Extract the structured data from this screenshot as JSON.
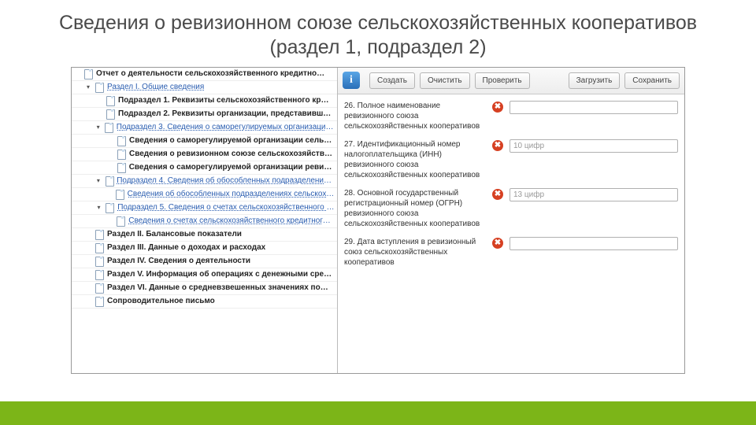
{
  "slide": {
    "title": "Сведения о ревизионном союзе сельскохозяйственных кооперативов (раздел 1, подраздел 2)"
  },
  "tree": {
    "items": [
      {
        "level": 0,
        "toggle": "",
        "bold": true,
        "link": false,
        "label": "Отчет о деятельности сельскохозяйственного кредитно…"
      },
      {
        "level": 1,
        "toggle": "▾",
        "bold": false,
        "link": true,
        "label": "Раздел I. Общие сведения"
      },
      {
        "level": 2,
        "toggle": "",
        "bold": true,
        "link": false,
        "label": "Подраздел 1. Реквизиты сельскохозяйственного кр…"
      },
      {
        "level": 2,
        "toggle": "",
        "bold": true,
        "link": false,
        "label": "Подраздел 2. Реквизиты организации, представивш…"
      },
      {
        "level": 2,
        "toggle": "▾",
        "bold": false,
        "link": true,
        "label": "Подраздел 3. Сведения о саморегулируемых организациях …"
      },
      {
        "level": 3,
        "toggle": "",
        "bold": true,
        "link": false,
        "label": "Сведения о саморегулируемой организации сель…"
      },
      {
        "level": 3,
        "toggle": "",
        "bold": true,
        "link": false,
        "label": "Сведения о ревизионном союзе сельскохозяйств…"
      },
      {
        "level": 3,
        "toggle": "",
        "bold": true,
        "link": false,
        "label": "Сведения о саморегулируемой организации ревиз…"
      },
      {
        "level": 2,
        "toggle": "▾",
        "bold": false,
        "link": true,
        "label": "Подраздел 4. Сведения об обособленных подразделениях …"
      },
      {
        "level": 3,
        "toggle": "",
        "bold": false,
        "link": true,
        "label": "Сведения об обособленных подразделениях сельскохоз…"
      },
      {
        "level": 2,
        "toggle": "▾",
        "bold": false,
        "link": true,
        "label": "Подраздел 5. Сведения о счетах сельскохозяйственного к…"
      },
      {
        "level": 3,
        "toggle": "",
        "bold": false,
        "link": true,
        "label": "Сведения о счетах сельскохозяйственного кредитного …"
      },
      {
        "level": 1,
        "toggle": "",
        "bold": true,
        "link": false,
        "label": "Раздел II. Балансовые показатели"
      },
      {
        "level": 1,
        "toggle": "",
        "bold": true,
        "link": false,
        "label": "Раздел III. Данные о доходах и расходах"
      },
      {
        "level": 1,
        "toggle": "",
        "bold": true,
        "link": false,
        "label": "Раздел IV. Сведения о деятельности"
      },
      {
        "level": 1,
        "toggle": "",
        "bold": true,
        "link": false,
        "label": "Раздел V. Информация об операциях с денежными сре…"
      },
      {
        "level": 1,
        "toggle": "",
        "bold": true,
        "link": false,
        "label": "Раздел VI. Данные о средневзвешенных значениях по…"
      },
      {
        "level": 1,
        "toggle": "",
        "bold": true,
        "link": false,
        "label": "Сопроводительное письмо"
      }
    ]
  },
  "toolbar": {
    "create": "Создать",
    "clear": "Очистить",
    "check": "Проверить",
    "load": "Загрузить",
    "save": "Сохранить"
  },
  "fields": [
    {
      "label": "26. Полное наименование ревизионного союза сельскохозяйственных кооперативов",
      "placeholder": ""
    },
    {
      "label": "27. Идентификационный номер налогоплательщика (ИНН) ревизионного союза сельскохозяйственных кооперативов",
      "placeholder": "10 цифр"
    },
    {
      "label": "28. Основной государственный регистрационный номер (ОГРН) ревизионного союза сельскохозяйственных кооперативов",
      "placeholder": "13 цифр"
    },
    {
      "label": "29. Дата вступления в ревизионный союз сельскохозяйственных кооперативов",
      "placeholder": ""
    }
  ]
}
